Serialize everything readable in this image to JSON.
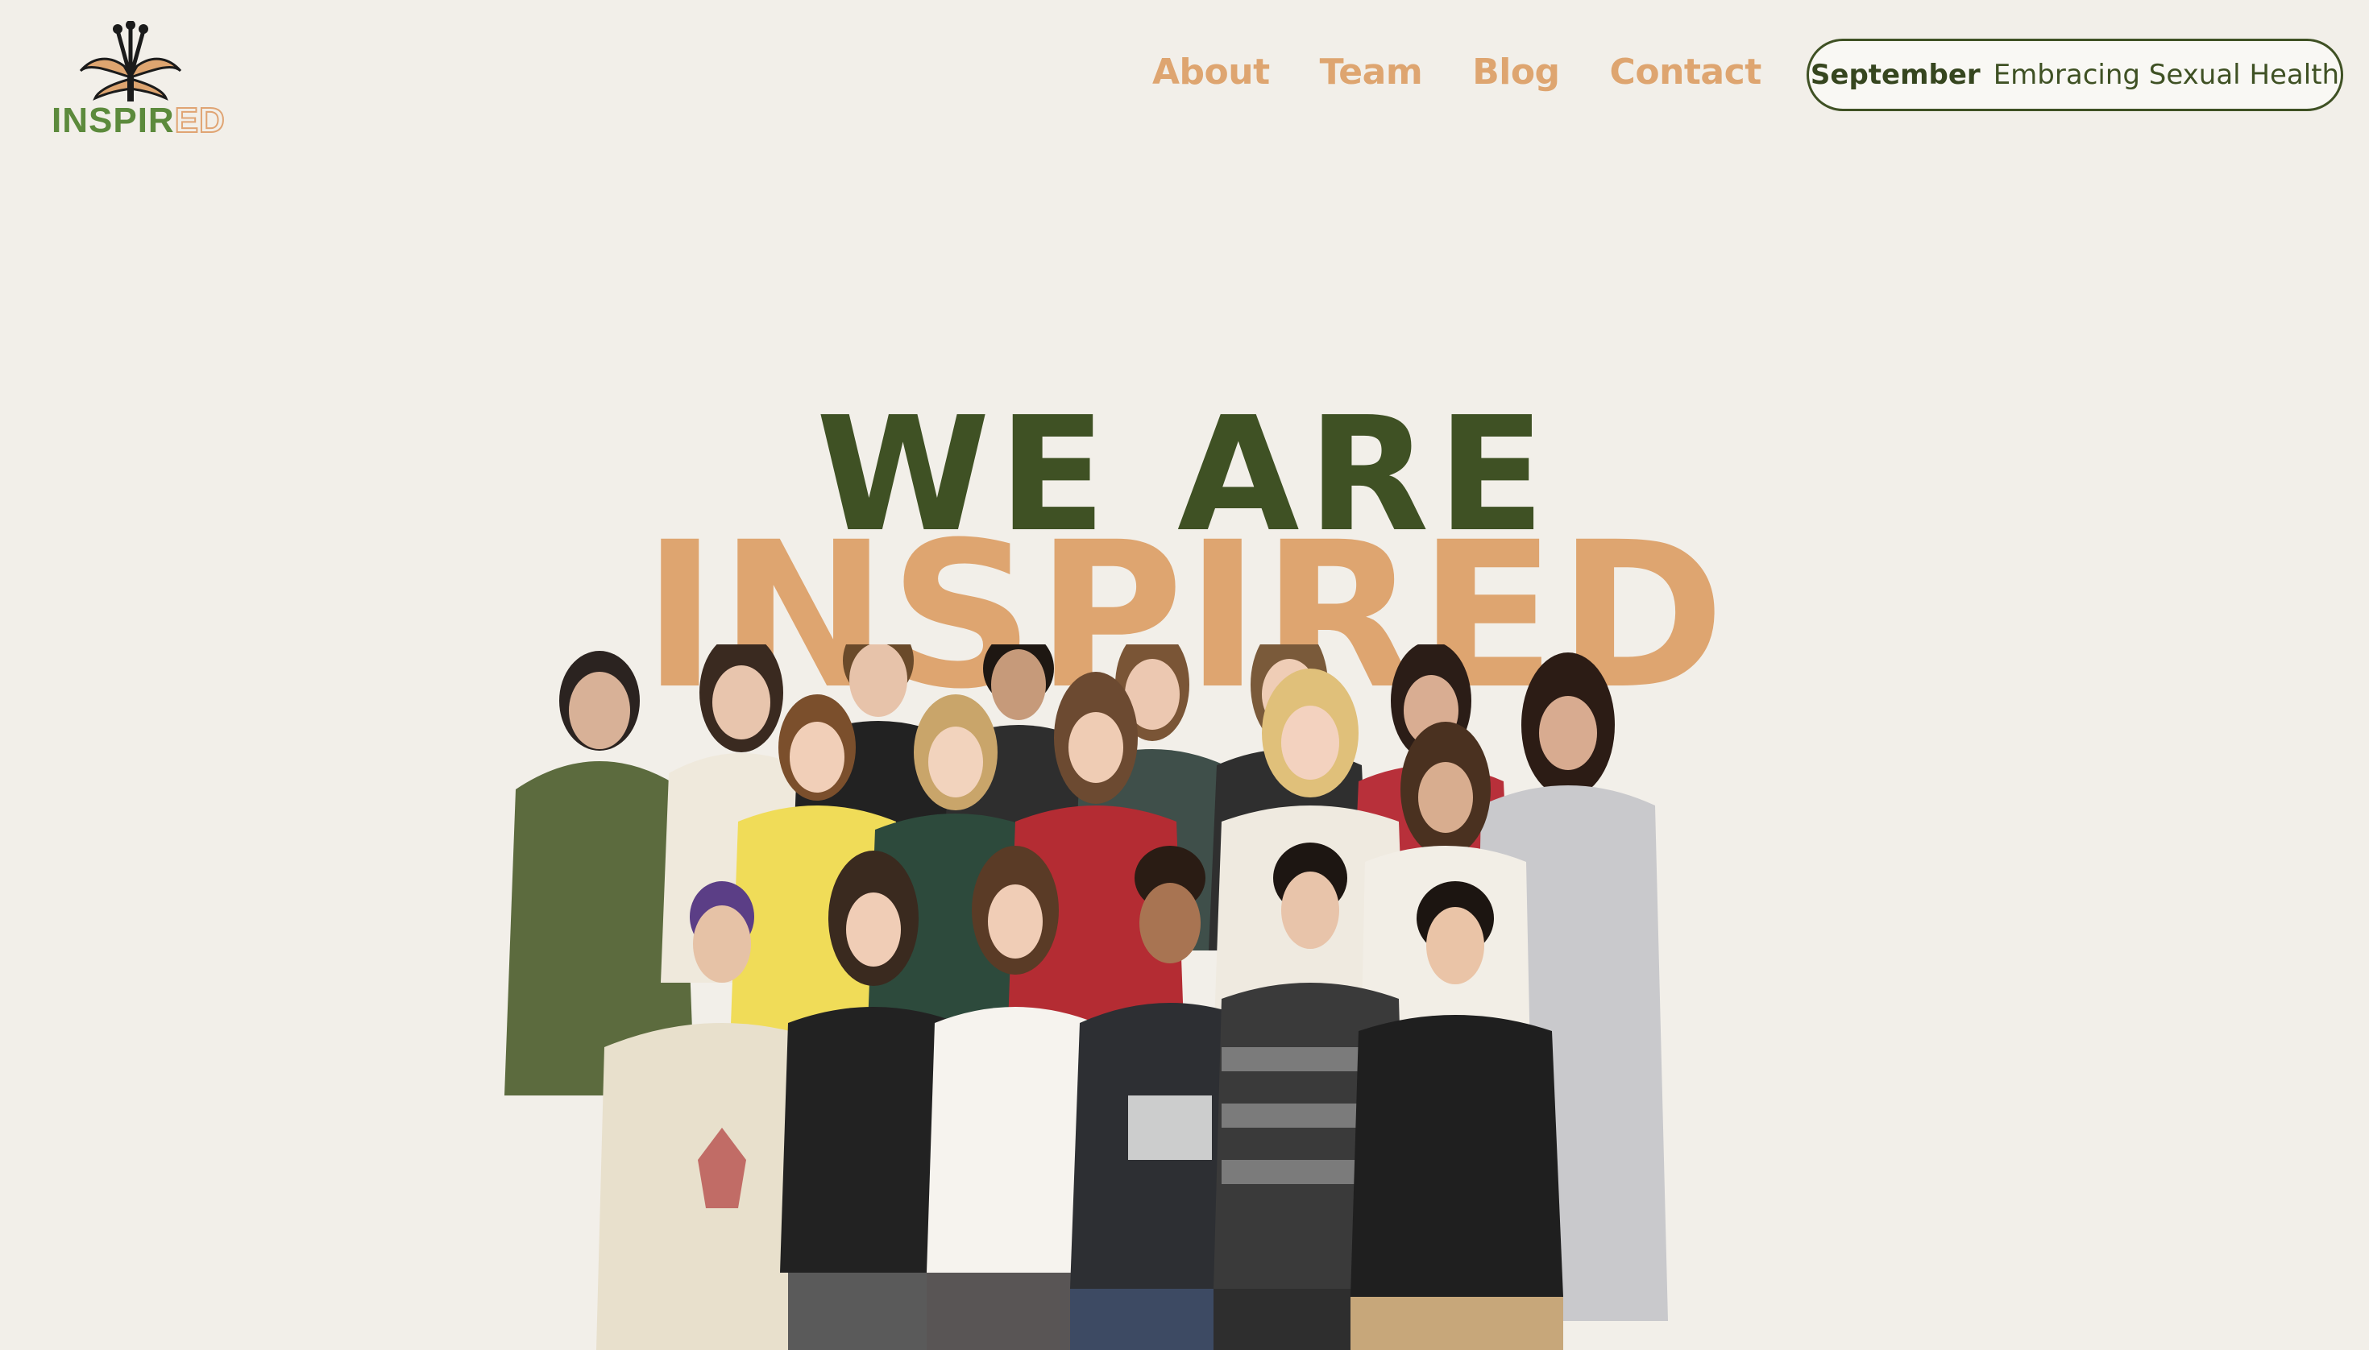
{
  "header": {
    "logo": {
      "text_part_1": "INSP",
      "text_part_2": "IR",
      "text_part_3": "ED",
      "icon": "lily-flower-icon"
    },
    "nav": [
      {
        "label": "About"
      },
      {
        "label": "Team"
      },
      {
        "label": "Blog"
      },
      {
        "label": "Contact"
      }
    ],
    "monthly_pill": {
      "month": "September",
      "topic": "Embracing Sexual Health"
    }
  },
  "hero": {
    "line1": "WE ARE",
    "line2": "INSPIRED",
    "image": "team-group-photo"
  },
  "colors": {
    "background": "#f2efe9",
    "dark_green": "#3f5124",
    "accent_orange": "#dea570"
  }
}
